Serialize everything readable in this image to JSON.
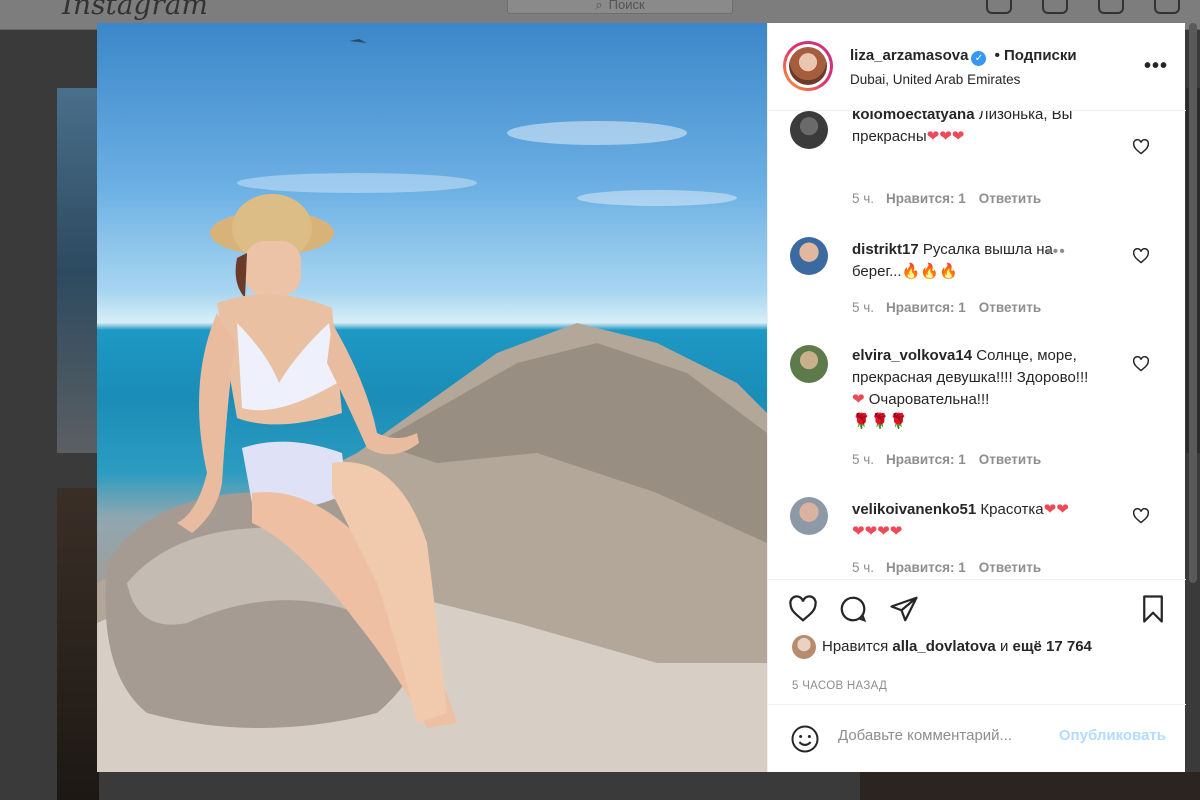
{
  "app": {
    "logo": "Instagram",
    "search_placeholder": "Поиск"
  },
  "post": {
    "username": "liza_arzamasova",
    "verified_mark": "✓",
    "follow_label": "• Подписки",
    "location": "Dubai, United Arab Emirates",
    "more_label": "•••"
  },
  "comments": [
    {
      "user": "kolomoectatyana",
      "text": "Лизонька, Вы прекрасны",
      "emoji": "❤❤❤",
      "time": "5 ч.",
      "likes": "Нравится: 1",
      "reply": "Ответить"
    },
    {
      "user": "distrikt17",
      "text": "Русалка вышла на берег...",
      "emoji": "🔥🔥🔥",
      "time": "5 ч.",
      "likes": "Нравится: 1",
      "reply": "Ответить",
      "more": "•••"
    },
    {
      "user": "elvira_volkova14",
      "text": "Солнце, море, прекрасная девушка!!!! Здорово!!!",
      "emoji_mid": "❤",
      "text2": "Очаровательна!!!",
      "emoji": "🌹🌹🌹",
      "time": "5 ч.",
      "likes": "Нравится: 1",
      "reply": "Ответить"
    },
    {
      "user": "velikoivanenko51",
      "text": "Красотка",
      "emoji": "❤❤",
      "emoji2": "❤❤❤❤",
      "time": "5 ч.",
      "likes": "Нравится: 1",
      "reply": "Ответить"
    }
  ],
  "likes_line": {
    "prefix": "Нравится",
    "user": "alla_dovlatova",
    "mid": "и",
    "count": "ещё 17 764"
  },
  "posted_ago": "5 ЧАСОВ НАЗАД",
  "composer": {
    "placeholder": "Добавьте комментарий...",
    "publish": "Опубликовать"
  },
  "colors": {
    "link_blue": "#b3dbff",
    "verified": "#3897f0",
    "heart_red": "#ed4956"
  }
}
